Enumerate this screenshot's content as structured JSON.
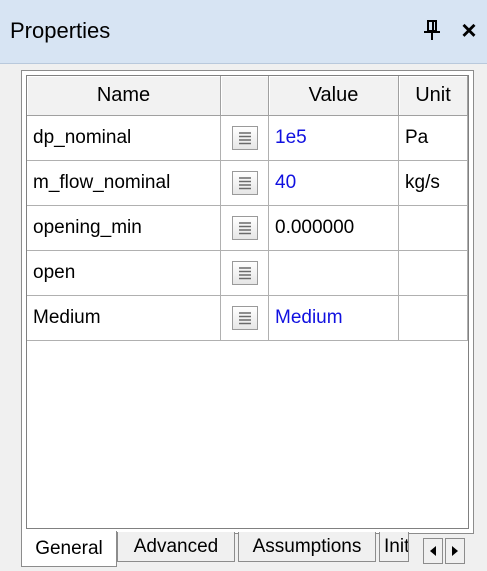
{
  "panel": {
    "title": "Properties",
    "close_glyph": "×"
  },
  "table": {
    "columns": [
      "Name",
      "",
      "Value",
      "Unit"
    ],
    "rows": [
      {
        "name": "dp_nominal",
        "value": "1e5",
        "unit": "Pa"
      },
      {
        "name": "m_flow_nominal",
        "value": "40",
        "unit": "kg/s"
      },
      {
        "name": "opening_min",
        "value": "0.000000",
        "unit": ""
      },
      {
        "name": "open",
        "value": "",
        "unit": ""
      },
      {
        "name": "Medium",
        "value": "Medium",
        "unit": ""
      }
    ]
  },
  "tabs": [
    {
      "label": "General",
      "active": true
    },
    {
      "label": "Advanced",
      "active": false
    },
    {
      "label": "Assumptions",
      "active": false
    },
    {
      "label": "Init",
      "active": false
    }
  ],
  "icons": {
    "pin": "pin-icon",
    "close": "close-icon",
    "edit": "edit-list-icon",
    "scroll_left": "scroll-left-icon",
    "scroll_right": "scroll-right-icon"
  },
  "colors": {
    "title_bar": "#d7e4f3",
    "value_text": "#1010e0"
  }
}
